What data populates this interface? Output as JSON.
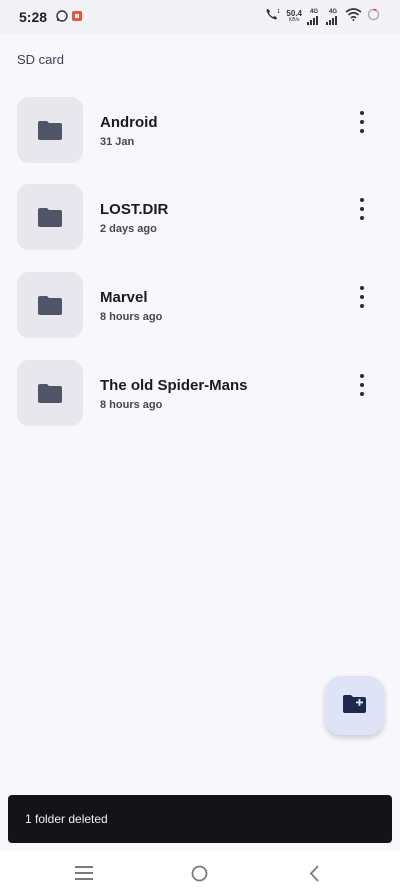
{
  "status_bar": {
    "time": "5:28",
    "net_speed_value": "50.4",
    "net_speed_unit": "KB/s",
    "sim1_type": "4G",
    "sim2_type": "4G",
    "icons": [
      "whatsapp-icon",
      "app-notification-icon",
      "wifi-calling-icon",
      "signal-icon",
      "wifi-icon",
      "battery-icon"
    ]
  },
  "breadcrumb": {
    "label": "SD card"
  },
  "folders": [
    {
      "name": "Android",
      "date": "31 Jan"
    },
    {
      "name": "LOST.DIR",
      "date": "2 days ago"
    },
    {
      "name": "Marvel",
      "date": "8 hours ago"
    },
    {
      "name": "The old Spider-Mans",
      "date": "8 hours ago"
    }
  ],
  "fab": {
    "icon": "create-new-folder-icon"
  },
  "snackbar": {
    "message": "1 folder deleted"
  },
  "navigation": {
    "buttons": [
      "recents-icon",
      "home-icon",
      "back-icon"
    ]
  },
  "colors": {
    "background": "#f8f7fc",
    "tile": "#e8e7ee",
    "folder_icon": "#4f5466",
    "fab": "#dfe3f8",
    "snackbar": "#131318"
  }
}
